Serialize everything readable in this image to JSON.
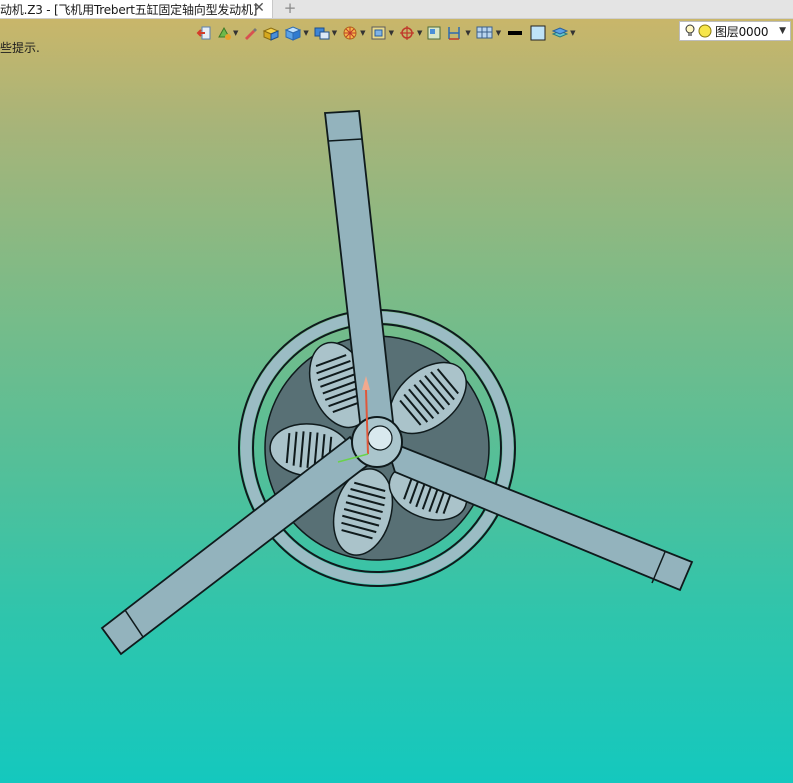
{
  "tab": {
    "title": "动机.Z3 - [飞机用Trebert五缸固定轴向型发动机]",
    "close_glyph": "✕",
    "new_tab_glyph": "+"
  },
  "viewport": {
    "hint": "些提示."
  },
  "toolbar": {
    "items": [
      {
        "name": "exit-icon"
      },
      {
        "name": "paint-icon"
      },
      {
        "name": "pencil-icon"
      },
      {
        "name": "shaded-box-icon"
      },
      {
        "name": "cube-view-icon"
      },
      {
        "name": "display-mode-icon"
      },
      {
        "name": "render-style-icon"
      },
      {
        "name": "view-frame-icon"
      },
      {
        "name": "snap-target-icon"
      },
      {
        "name": "window-icon"
      },
      {
        "name": "dimension-icon"
      },
      {
        "name": "grid-icon"
      },
      {
        "name": "line-color-swatch"
      },
      {
        "name": "fill-color-swatch"
      },
      {
        "name": "layer-stack-icon"
      }
    ],
    "layer": {
      "name": "图层0000"
    }
  },
  "colors": {
    "viewport_top": "#c9b66a",
    "viewport_bottom": "#14c8be",
    "blade": "#93b3bd",
    "outline": "#0f1a1c"
  }
}
